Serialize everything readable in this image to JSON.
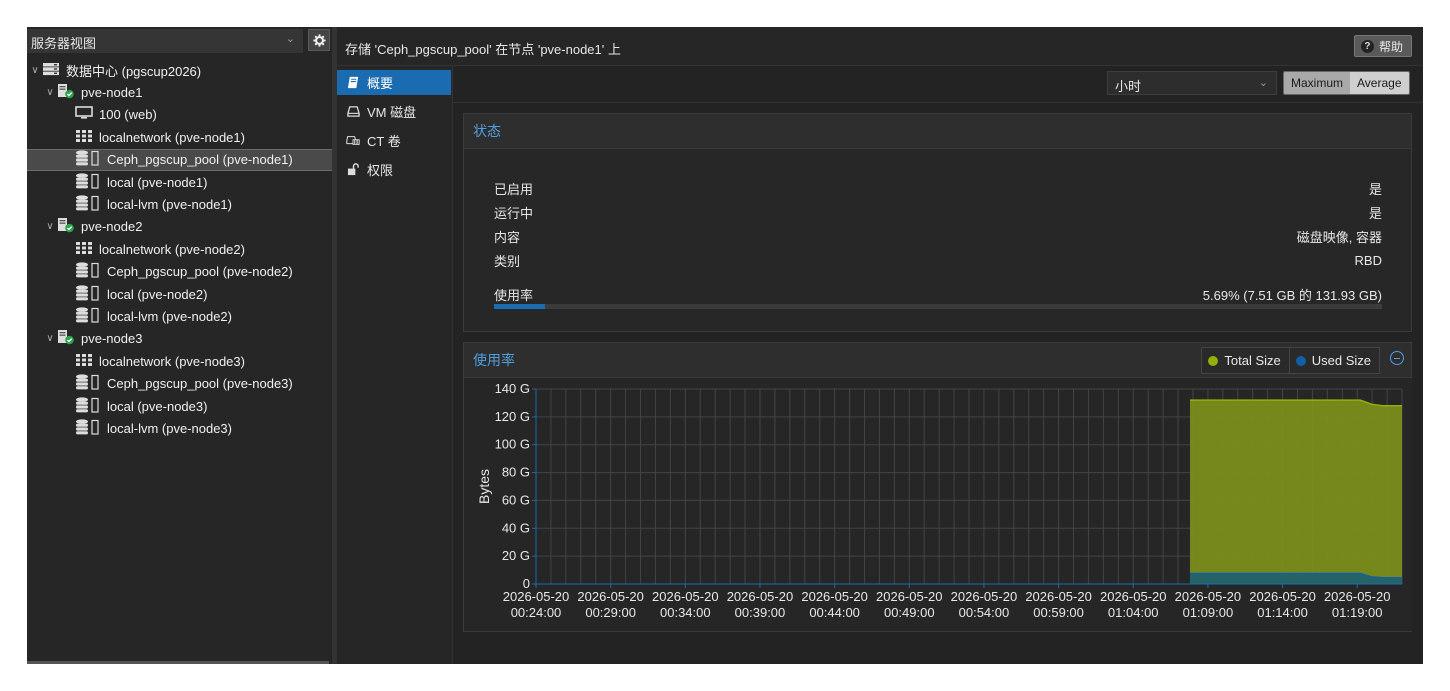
{
  "left_panel": {
    "view_selector": "服务器视图",
    "tree": [
      {
        "label": "数据中心 (pgscup2026)",
        "type": "datacenter",
        "indent": 0,
        "expanded": true
      },
      {
        "label": "pve-node1",
        "type": "node",
        "indent": 1,
        "expanded": true
      },
      {
        "label": "100 (web)",
        "type": "vm",
        "indent": 2
      },
      {
        "label": "localnetwork (pve-node1)",
        "type": "network",
        "indent": 2
      },
      {
        "label": "Ceph_pgscup_pool (pve-node1)",
        "type": "storage",
        "indent": 2,
        "selected": true
      },
      {
        "label": "local (pve-node1)",
        "type": "storage",
        "indent": 2
      },
      {
        "label": "local-lvm (pve-node1)",
        "type": "storage",
        "indent": 2
      },
      {
        "label": "pve-node2",
        "type": "node",
        "indent": 1,
        "expanded": true
      },
      {
        "label": "localnetwork (pve-node2)",
        "type": "network",
        "indent": 2
      },
      {
        "label": "Ceph_pgscup_pool (pve-node2)",
        "type": "storage",
        "indent": 2
      },
      {
        "label": "local (pve-node2)",
        "type": "storage",
        "indent": 2
      },
      {
        "label": "local-lvm (pve-node2)",
        "type": "storage",
        "indent": 2
      },
      {
        "label": "pve-node3",
        "type": "node",
        "indent": 1,
        "expanded": true
      },
      {
        "label": "localnetwork (pve-node3)",
        "type": "network",
        "indent": 2
      },
      {
        "label": "Ceph_pgscup_pool (pve-node3)",
        "type": "storage",
        "indent": 2
      },
      {
        "label": "local (pve-node3)",
        "type": "storage",
        "indent": 2
      },
      {
        "label": "local-lvm (pve-node3)",
        "type": "storage",
        "indent": 2
      }
    ]
  },
  "header": {
    "title": "存储 'Ceph_pgscup_pool' 在节点 'pve-node1' 上",
    "help_label": "帮助"
  },
  "nav": [
    {
      "label": "概要",
      "icon": "book-icon",
      "active": true
    },
    {
      "label": "VM 磁盘",
      "icon": "hdd-icon"
    },
    {
      "label": "CT 卷",
      "icon": "ct-volume-icon"
    },
    {
      "label": "权限",
      "icon": "unlock-icon"
    }
  ],
  "toolbar": {
    "timeframe": "小时",
    "cf_maximum": "Maximum",
    "cf_average": "Average"
  },
  "status_panel": {
    "title": "状态",
    "rows": [
      {
        "key": "已启用",
        "value": "是"
      },
      {
        "key": "运行中",
        "value": "是"
      },
      {
        "key": "内容",
        "value": "磁盘映像, 容器"
      },
      {
        "key": "类别",
        "value": "RBD"
      }
    ],
    "usage_label": "使用率",
    "usage_text": "5.69% (7.51 GB 的 131.93 GB)",
    "usage_fraction": 0.0569
  },
  "usage_panel": {
    "title": "使用率",
    "legend": [
      {
        "label": "Total Size",
        "color": "#94ae0a"
      },
      {
        "label": "Used Size",
        "color": "#115fa6"
      }
    ]
  },
  "colors": {
    "accent": "#1a6bb0",
    "total_fill": "#7d8f1a",
    "used_fill": "#1f5f6e"
  },
  "chart_data": {
    "type": "area",
    "ylabel": "Bytes",
    "yticks": [
      "0",
      "20 G",
      "40 G",
      "60 G",
      "80 G",
      "100 G",
      "120 G",
      "140 G"
    ],
    "ylim": [
      0,
      140
    ],
    "xticks": [
      [
        "2026-05-20",
        "00:24:00"
      ],
      [
        "2026-05-20",
        "00:29:00"
      ],
      [
        "2026-05-20",
        "00:34:00"
      ],
      [
        "2026-05-20",
        "00:39:00"
      ],
      [
        "2026-05-20",
        "00:44:00"
      ],
      [
        "2026-05-20",
        "00:49:00"
      ],
      [
        "2026-05-20",
        "00:54:00"
      ],
      [
        "2026-05-20",
        "00:59:00"
      ],
      [
        "2026-05-20",
        "01:04:00"
      ],
      [
        "2026-05-20",
        "01:09:00"
      ],
      [
        "2026-05-20",
        "01:14:00"
      ],
      [
        "2026-05-20",
        "01:19:00"
      ]
    ],
    "x_minutes": [
      24,
      29,
      34,
      39,
      44,
      49,
      54,
      59,
      64,
      69,
      74,
      79
    ],
    "xlim_minutes": [
      24,
      82
    ],
    "series": [
      {
        "name": "Total Size",
        "color": "#94ae0a",
        "points": [
          [
            67.8,
            132
          ],
          [
            79.2,
            132
          ],
          [
            80,
            129
          ],
          [
            80.7,
            128
          ],
          [
            82,
            128
          ]
        ]
      },
      {
        "name": "Used Size",
        "color": "#115fa6",
        "points": [
          [
            67.8,
            7.5
          ],
          [
            79.2,
            7.5
          ],
          [
            80,
            5
          ],
          [
            80.7,
            4.5
          ],
          [
            82,
            4.5
          ]
        ]
      }
    ],
    "grid": true
  }
}
